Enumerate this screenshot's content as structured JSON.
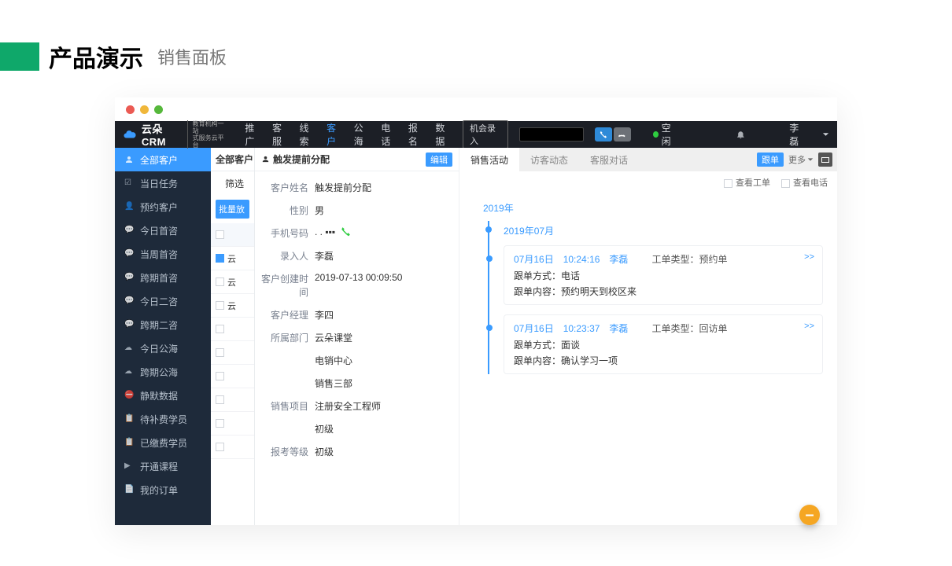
{
  "slide": {
    "title": "产品演示",
    "subtitle": "销售面板"
  },
  "topnav": {
    "brand": "云朵CRM",
    "brand_sub1": "教育机构一站",
    "brand_sub2": "式服务云平台",
    "items": [
      "推广",
      "客服",
      "线索",
      "客户",
      "公海",
      "电话",
      "报名",
      "数据"
    ],
    "active_index": 3,
    "opp_button": "机会录入",
    "status_label": "空闲",
    "user": "李磊"
  },
  "sidebar": {
    "header": "全部客户",
    "items": [
      "当日任务",
      "预约客户",
      "今日首咨",
      "当周首咨",
      "跨期首咨",
      "今日二咨",
      "跨期二咨",
      "今日公海",
      "跨期公海",
      "静默数据",
      "待补费学员",
      "已缴费学员",
      "开通课程",
      "我的订单"
    ]
  },
  "list": {
    "all_header": "全部客户",
    "filter_label": "筛选",
    "batch_button": "批量放",
    "rows": [
      {
        "label": "",
        "checked": false,
        "header": true
      },
      {
        "label": "云",
        "checked": true,
        "header": false
      },
      {
        "label": "云",
        "checked": false,
        "header": false
      },
      {
        "label": "云",
        "checked": false,
        "header": false
      },
      {
        "label": "",
        "checked": false,
        "header": false
      },
      {
        "label": "",
        "checked": false,
        "header": false
      },
      {
        "label": "",
        "checked": false,
        "header": false
      },
      {
        "label": "",
        "checked": false,
        "header": false
      },
      {
        "label": "",
        "checked": false,
        "header": false
      },
      {
        "label": "",
        "checked": false,
        "header": false
      }
    ]
  },
  "detail": {
    "title": "触发提前分配",
    "edit_label": "编辑",
    "fields": [
      {
        "label": "客户姓名",
        "value": "触发提前分配"
      },
      {
        "label": "性别",
        "value": "男"
      },
      {
        "label": "手机号码",
        "value": ". . ▪▪▪",
        "phone": true
      },
      {
        "label": "录入人",
        "value": "李磊"
      },
      {
        "label": "客户创建时间",
        "value": "2019-07-13 00:09:50"
      },
      {
        "label": "客户经理",
        "value": "李四"
      },
      {
        "label": "所属部门",
        "value": "云朵课堂"
      },
      {
        "label": "",
        "value": "电销中心"
      },
      {
        "label": "",
        "value": "销售三部"
      },
      {
        "label": "销售项目",
        "value": "注册安全工程师"
      },
      {
        "label": "",
        "value": "初级"
      },
      {
        "label": "报考等级",
        "value": "初级"
      }
    ]
  },
  "right": {
    "tabs": [
      "销售活动",
      "访客动态",
      "客服对话"
    ],
    "active_tab": 0,
    "follow_button": "跟单",
    "more_label": "更多",
    "filter_ticket": "查看工单",
    "filter_call": "查看电话"
  },
  "timeline": {
    "year": "2019年",
    "month": "2019年07月",
    "entries": [
      {
        "date": "07月16日",
        "time": "10:24:16",
        "user": "李磊",
        "type_label": "工单类型：",
        "type_value": "预约单",
        "mode_label": "跟单方式：",
        "mode_value": "电话",
        "content_label": "跟单内容：",
        "content_value": "预约明天到校区来",
        "expand": ">>"
      },
      {
        "date": "07月16日",
        "time": "10:23:37",
        "user": "李磊",
        "type_label": "工单类型：",
        "type_value": "回访单",
        "mode_label": "跟单方式：",
        "mode_value": "面谈",
        "content_label": "跟单内容：",
        "content_value": "确认学习一项",
        "expand": ">>"
      }
    ]
  }
}
